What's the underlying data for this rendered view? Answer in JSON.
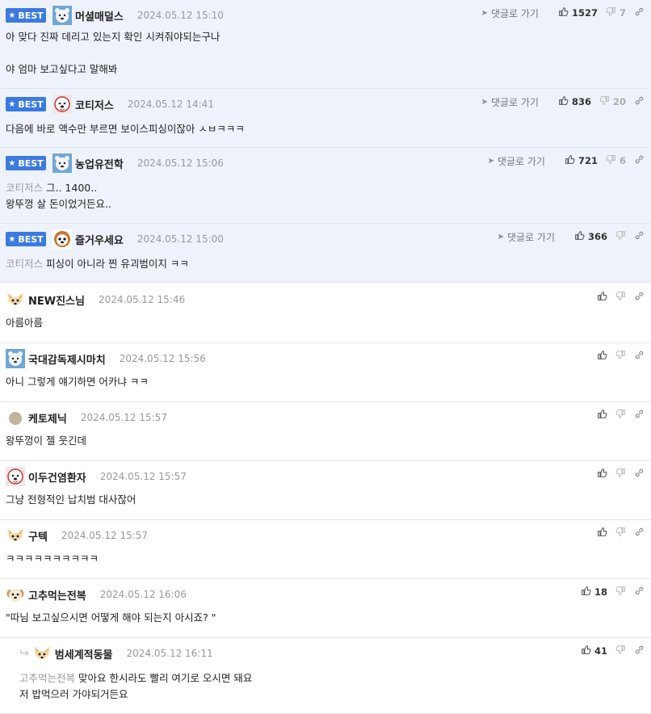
{
  "best_label": "BEST",
  "goto_label": "댓글로 가기",
  "best_comments": [
    {
      "nick": "머셜매덜스",
      "date": "2024.05.12 15:10",
      "avatar": "polar-bear-avatar",
      "mention": "",
      "text": "아 맞다 진짜 데리고 있는지 확인 시켜줘야되는구나\n\n야 엄마 보고싶다고 말해봐",
      "up": "1527",
      "down": "7"
    },
    {
      "nick": "코티저스",
      "date": "2024.05.12 14:41",
      "avatar": "dog-avatar",
      "mention": "",
      "text": "다음에 바로 액수만 부르면 보이스피싱이잖아 ㅅㅂㅋㅋㅋ",
      "up": "836",
      "down": "20"
    },
    {
      "nick": "농업유전학",
      "date": "2024.05.12 15:06",
      "avatar": "polar-bear-avatar",
      "mention": "코티저스",
      "text": "그.. 1400..\n왕뚜껑 살 돈이었거든요..",
      "up": "721",
      "down": "6"
    },
    {
      "nick": "즐거우세요",
      "date": "2024.05.12 15:00",
      "avatar": "bear-avatar",
      "mention": "코티저스",
      "text": "피싱이 아니라 찐 유괴범이지 ㅋㅋ",
      "up": "366",
      "down": ""
    }
  ],
  "comments": [
    {
      "nick": "NEW진스님",
      "date": "2024.05.12 15:46",
      "avatar": "fox-avatar",
      "mention": "",
      "text": "아름아름",
      "up": ""
    },
    {
      "nick": "국대감독제시마치",
      "date": "2024.05.12 15:56",
      "avatar": "polar-bear-avatar",
      "mention": "",
      "text": "아니 그렇게 얘기하면 어카냐 ㅋㅋ",
      "up": ""
    },
    {
      "nick": "케토제닉",
      "date": "2024.05.12 15:57",
      "avatar": "circle-avatar",
      "mention": "",
      "text": "왕뚜껑이 젤 웃긴데",
      "up": ""
    },
    {
      "nick": "이두건염환자",
      "date": "2024.05.12 15:57",
      "avatar": "dog-avatar",
      "mention": "",
      "text": "그냥 전형적인 납치범 대사잖어",
      "up": ""
    },
    {
      "nick": "구텍",
      "date": "2024.05.12 15:57",
      "avatar": "fox-avatar",
      "mention": "",
      "text": "ㅋㅋㅋㅋㅋㅋㅋㅋㅋㅋ",
      "up": ""
    },
    {
      "nick": "고추먹는전복",
      "date": "2024.05.12 16:06",
      "avatar": "puppy-avatar",
      "mention": "",
      "text": "\"따님 보고싶으시면 어떻게 해야 되는지 아시죠? \"",
      "up": "18"
    }
  ],
  "reply": {
    "nick": "범세계적동물",
    "date": "2024.05.12 16:11",
    "avatar": "fox-avatar",
    "mention": "고추먹는전복",
    "text": "맞아요 한시라도 빨리 여기로 오시면 돼요\n저 밥먹으러 가야되거든요",
    "up": "41"
  },
  "colors": {
    "accent": "#3c7ae0",
    "best_bg": "#eef3fb",
    "muted": "#999999"
  }
}
